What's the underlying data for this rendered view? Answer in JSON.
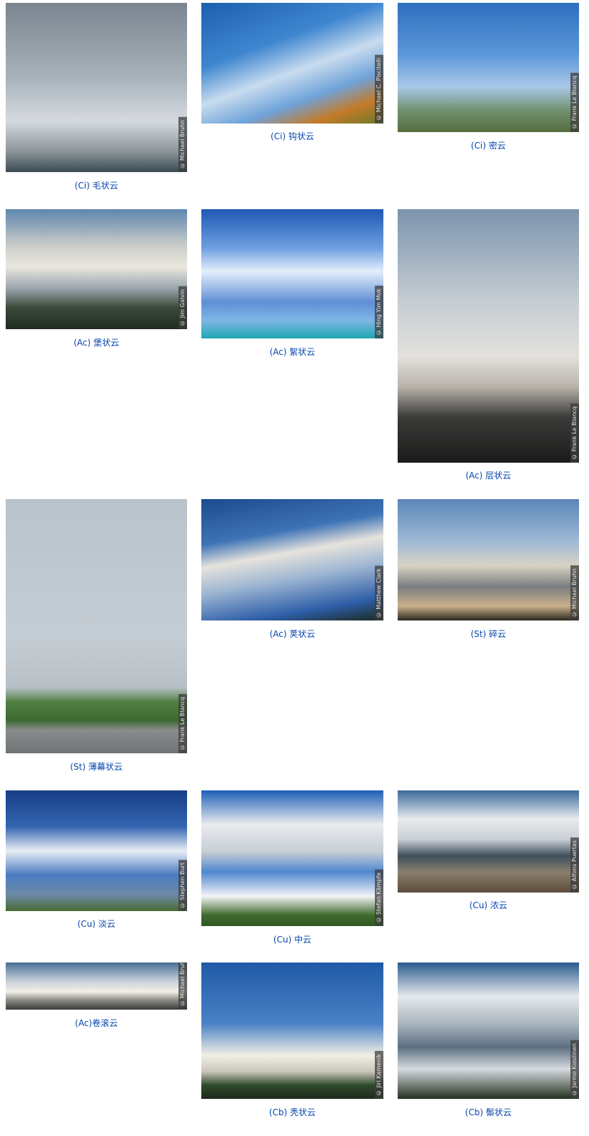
{
  "cells": [
    {
      "credit": "© Michael Bruhn",
      "caption": "(Ci) 毛状云",
      "bg": "linear-gradient(180deg,#7a8590 0%,#a9b3bb 45%,#d5dadf 70%,#8b9499 88%,#3b4a52 100%)"
    },
    {
      "credit": "© Michael C. Piscitelli",
      "caption": "(Ci) 钩状云",
      "bg": "linear-gradient(160deg,#1d5fae 0%,#3f86d0 35%,#c9dcef 55%,#6fa3d9 72%,#c47a28 86%,#6a7a2a 100%)"
    },
    {
      "credit": "© Frank Le Blancq",
      "caption": "(Ci) 密云",
      "bg": "linear-gradient(180deg,#2e6fc0 0%,#5b97d8 40%,#a9c8e8 65%,#6f8f6a 84%,#556e3f 100%)"
    },
    {
      "credit": "© Jim Galvin",
      "caption": "(Ac) 堡状云",
      "bg": "linear-gradient(180deg,#5e86ad 0%,#c9ccc9 30%,#eae7dd 48%,#9aa6ad 66%,#3b4a3a 82%,#1f2a1f 100%)"
    },
    {
      "credit": "© Hing Yim Mok",
      "caption": "(Ac) 絮状云",
      "bg": "linear-gradient(180deg,#1f58b4 0%,#6d9fe0 30%,#e4eefb 48%,#5f8fd6 72%,#7fb6e6 86%,#1fa7b0 100%)"
    },
    {
      "credit": "© Frank Le Blancq",
      "caption": "(Ac) 层状云",
      "bg": "linear-gradient(180deg,#7c93ad 0%,#c3cbd2 35%,#e3e1dc 58%,#b9b4ab 70%,#3a3a38 82%,#1b1b1b 100%)"
    },
    {
      "credit": "© Frank Le Blancq",
      "caption": "(St) 薄幕状云",
      "bg": "linear-gradient(180deg,#b9c3cb 0%,#c5cdd4 55%,#b7c0c6 74%,#4f7f3f 80%,#3e6a32 87%,#8a8c8d 91%,#6f7374 100%)"
    },
    {
      "credit": "© Matthew Clark",
      "caption": "(Ac) 荚状云",
      "bg": "linear-gradient(170deg,#1c4a8e 0%,#3e73b6 30%,#e6e3dc 45%,#9fb7d2 62%,#2d5ea8 85%,#1d2a1d 100%)"
    },
    {
      "credit": "© Michael Bruhn",
      "caption": "(St) 碎云",
      "bg": "linear-gradient(180deg,#5c86b8 0%,#9fbad6 35%,#d9d2c4 55%,#7a7d80 72%,#c9b08a 88%,#2a2a22 100%)"
    },
    {
      "credit": "© Stephen Burt",
      "caption": "(Cu) 淡云",
      "bg": "linear-gradient(180deg,#173e86 0%,#3365b0 30%,#eaeef4 50%,#4a7bc2 70%,#6d8aa8 86%,#4a6a32 100%)"
    },
    {
      "credit": "© Stefan Kämpfe",
      "caption": "(Cu) 中云",
      "bg": "linear-gradient(180deg,#1d5fb6 0%,#e9ecef 25%,#c8ced4 45%,#4f87cf 60%,#f2f4f6 78%,#3f6a2c 92%,#2f5a22 100%)"
    },
    {
      "credit": "© Alfons Puertas",
      "caption": "(Cu) 浓云",
      "bg": "linear-gradient(180deg,#3c6a9a 0%,#e7ebee 28%,#c9cfd4 48%,#3f4f5c 64%,#8a7f6e 80%,#5d4b3b 100%)"
    },
    {
      "credit": "© Michael Bruhn",
      "caption": "(Ac)卷滚云",
      "bg": "linear-gradient(180deg,#4a6f96 0%,#c9d2da 40%,#f3f0e6 62%,#8b8a86 80%,#3b3b37 100%)"
    },
    {
      "credit": "© Jiri Kamenik",
      "caption": "(Cb) 秃状云",
      "bg": "linear-gradient(180deg,#1f5aa6 0%,#4b82c6 45%,#f2efe6 68%,#c9c5ba 80%,#2f4a2a 90%,#1d2a1d 100%)"
    },
    {
      "credit": "© Jarmo Koistinen",
      "caption": "(Cb) 鬃状云",
      "bg": "linear-gradient(180deg,#2a5b8c 0%,#e6eaee 25%,#a9b4bd 45%,#5c6f80 62%,#d6dbe0 78%,#24301f 100%)"
    }
  ]
}
